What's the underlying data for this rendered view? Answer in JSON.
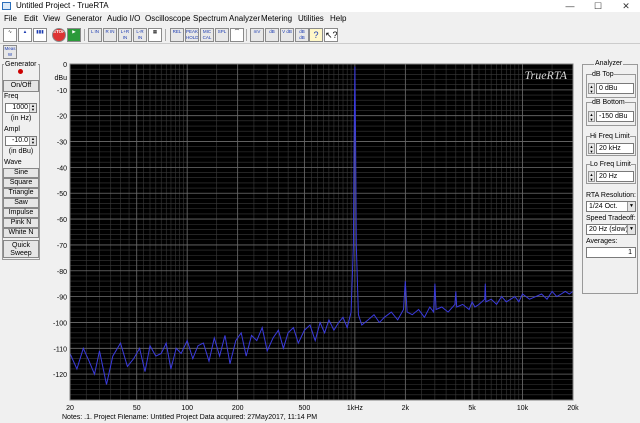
{
  "window": {
    "title": "Untitled Project - TrueRTA"
  },
  "menu": [
    "File",
    "Edit",
    "View",
    "Generator",
    "Audio I/O",
    "Oscilloscope",
    "Spectrum Analyzer",
    "Metering",
    "Utilities",
    "Help"
  ],
  "toolbar": {
    "row1": [
      "",
      "",
      "",
      "STOP",
      "",
      "L IN",
      "R IN",
      "L+R IN",
      "L-R IN",
      "",
      "REL",
      "PEAK HOLD",
      "MIC CAL",
      "SPL",
      "",
      "mV",
      "dB",
      "V dB",
      "dB dB",
      "",
      "?",
      "?"
    ],
    "row2": [
      "Meas W"
    ]
  },
  "generator": {
    "title": "Generator",
    "onoff": "On/Off",
    "freq_label": "Freq",
    "freq_value": "1000",
    "freq_unit": "(in Hz)",
    "ampl_label": "Ampl",
    "ampl_value": "-10.0",
    "ampl_unit": "(in dBu)",
    "wave_label": "Wave",
    "waves": [
      "Sine",
      "Square",
      "Triangle",
      "Saw",
      "Impulse",
      "Pink N",
      "White N"
    ],
    "quick_sweep": "Quick Sweep"
  },
  "analyzer": {
    "title": "Analyzer",
    "db_top_label": "dB Top",
    "db_top_value": "0 dBu",
    "db_bottom_label": "dB Bottom",
    "db_bottom_value": "-150 dBu",
    "hi_freq_label": "Hi Freq Limit",
    "hi_freq_value": "20 kHz",
    "lo_freq_label": "Lo Freq Limit",
    "lo_freq_value": "20 Hz",
    "rta_res_label": "RTA Resolution:",
    "rta_res_value": "1/24 Oct.",
    "speed_label": "Speed Tradeoff:",
    "speed_value": "20 Hz (slow)",
    "averages_label": "Averages:",
    "averages_value": "1"
  },
  "notes": {
    "text": "Notes: .1. Project Filename: Untitled Project    Data acquired: 27May2017, 11:14 PM"
  },
  "chart_data": {
    "type": "line",
    "title": "TrueRTA",
    "ylabel": "dBu",
    "xscale": "log",
    "xlim": [
      20,
      20000
    ],
    "ylim": [
      -130,
      0
    ],
    "yticks": [
      0,
      -10,
      -20,
      -30,
      -40,
      -50,
      -60,
      -70,
      -80,
      -90,
      -100,
      -110,
      -120
    ],
    "ytick_labels": [
      "0",
      "-10",
      "-20",
      "-30",
      "-40",
      "-50",
      "-60",
      "-70",
      "-80",
      "-90",
      "-100",
      "-110",
      "-120"
    ],
    "xticks": [
      20,
      50,
      100,
      200,
      500,
      1000,
      2000,
      5000,
      10000,
      20000
    ],
    "xtick_labels": [
      "20",
      "50",
      "100",
      "200",
      "500",
      "1kHz",
      "2k",
      "5k",
      "10k",
      "20k"
    ],
    "line_color": "#3b3bdc",
    "background": "#000000",
    "grid": true,
    "series": [
      {
        "x": [
          20,
          22,
          24,
          26,
          28,
          30,
          33,
          36,
          40,
          44,
          48,
          52,
          56,
          60,
          65,
          70,
          75,
          80,
          86,
          92,
          100,
          108,
          116,
          125,
          135,
          145,
          156,
          168,
          180,
          195,
          210,
          225,
          242,
          260,
          280,
          300,
          325,
          350,
          375,
          400,
          430,
          460,
          500,
          540,
          580,
          620,
          660,
          700,
          750,
          800,
          850,
          900,
          950,
          980,
          990,
          1000,
          1010,
          1020,
          1050,
          1100,
          1200,
          1300,
          1400,
          1500,
          1650,
          1800,
          1950,
          2000,
          2050,
          2200,
          2400,
          2600,
          2800,
          2950,
          3000,
          3050,
          3300,
          3600,
          3950,
          4000,
          4050,
          4400,
          4800,
          5000,
          5200,
          5500,
          5950,
          6000,
          6050,
          6500,
          7000,
          7500,
          8000,
          8500,
          9000,
          9500,
          10000,
          11000,
          12000,
          13000,
          14000,
          15000,
          16000,
          17000,
          18000,
          19000,
          20000
        ],
        "y": [
          -112,
          -118,
          -110,
          -115,
          -120,
          -111,
          -124,
          -113,
          -108,
          -117,
          -114,
          -110,
          -119,
          -109,
          -113,
          -112,
          -108,
          -118,
          -110,
          -112,
          -107,
          -114,
          -109,
          -108,
          -115,
          -106,
          -113,
          -105,
          -116,
          -107,
          -104,
          -113,
          -105,
          -107,
          -102,
          -111,
          -106,
          -103,
          -110,
          -104,
          -102,
          -108,
          -103,
          -101,
          -107,
          -100,
          -104,
          -99,
          -103,
          -100,
          -98,
          -102,
          -96,
          -70,
          -30,
          -1,
          -30,
          -70,
          -97,
          -101,
          -99,
          -97,
          -100,
          -98,
          -96,
          -99,
          -95,
          -84,
          -96,
          -97,
          -95,
          -98,
          -94,
          -96,
          -85,
          -95,
          -94,
          -96,
          -93,
          -88,
          -94,
          -93,
          -95,
          -92,
          -94,
          -93,
          -91,
          -85,
          -92,
          -91,
          -93,
          -90,
          -92,
          -91,
          -90,
          -92,
          -89,
          -91,
          -90,
          -89,
          -91,
          -88,
          -90,
          -89,
          -88,
          -89,
          -88
        ]
      }
    ]
  }
}
